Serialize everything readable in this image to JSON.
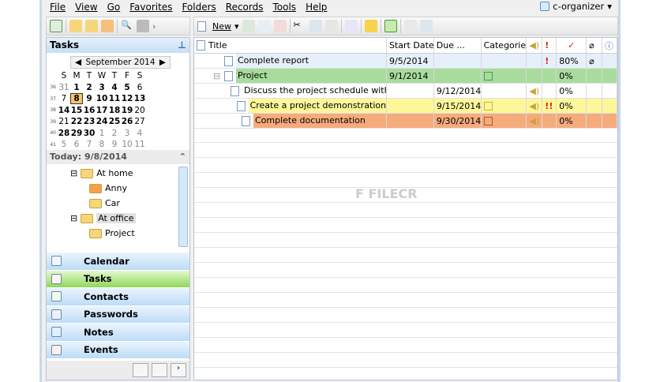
{
  "menu": [
    "File",
    "View",
    "Go",
    "Favorites",
    "Folders",
    "Records",
    "Tools",
    "Help"
  ],
  "org_switch": "c-organizer",
  "toolbar": {
    "new_label": "New"
  },
  "panel_title": "Tasks",
  "calendar": {
    "month": "September 2014",
    "days": [
      "S",
      "M",
      "T",
      "W",
      "T",
      "F",
      "S"
    ],
    "weeks": [
      {
        "n": "36",
        "d": [
          "31",
          "1",
          "2",
          "3",
          "4",
          "5",
          "6"
        ]
      },
      {
        "n": "37",
        "d": [
          "7",
          "8",
          "9",
          "10",
          "11",
          "12",
          "13"
        ]
      },
      {
        "n": "38",
        "d": [
          "14",
          "15",
          "16",
          "17",
          "18",
          "19",
          "20"
        ]
      },
      {
        "n": "39",
        "d": [
          "21",
          "22",
          "23",
          "24",
          "25",
          "26",
          "27"
        ]
      },
      {
        "n": "40",
        "d": [
          "28",
          "29",
          "30",
          "1",
          "2",
          "3",
          "4"
        ]
      },
      {
        "n": "41",
        "d": [
          "5",
          "6",
          "7",
          "8",
          "9",
          "10",
          "11"
        ]
      }
    ]
  },
  "today": "Today: 9/8/2014",
  "tree": [
    "At home",
    "Anny",
    "Car",
    "At office",
    "Project"
  ],
  "nav": [
    "Calendar",
    "Tasks",
    "Contacts",
    "Passwords",
    "Notes",
    "Events"
  ],
  "columns": [
    "Title",
    "Start Date",
    "Due ...",
    "Categories"
  ],
  "rows": [
    {
      "title": "Complete report",
      "start": "9/5/2014",
      "due": "",
      "pct": "80%",
      "prio": "!",
      "bg": "#e6f0fb"
    },
    {
      "title": "Project",
      "start": "9/1/2014",
      "due": "",
      "pct": "0%",
      "prio": "",
      "bg": "#a8dc9c"
    },
    {
      "title": "Discuss the project schedule with my...",
      "start": "",
      "due": "9/12/2014",
      "pct": "0%",
      "prio": "",
      "bg": "#ffffff"
    },
    {
      "title": "Create a project demonstration",
      "start": "",
      "due": "9/15/2014",
      "pct": "0%",
      "prio": "!!",
      "bg": "#fdf79a"
    },
    {
      "title": "Complete documentation",
      "start": "",
      "due": "9/30/2014",
      "pct": "0%",
      "prio": "",
      "bg": "#f6ab7c"
    }
  ],
  "watermark": "FILECR .com"
}
